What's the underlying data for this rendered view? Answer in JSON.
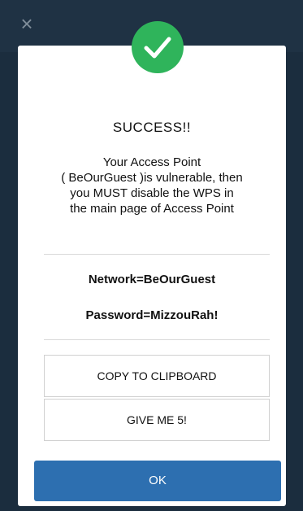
{
  "window": {
    "close_icon": "close-icon"
  },
  "dialog": {
    "icon": "check-icon",
    "accent_color": "#2fb45b",
    "title": "SUCCESS!!",
    "message_lines": [
      "Your Access Point",
      "( BeOurGuest )is vulnerable, then",
      "you MUST disable the WPS in",
      "the main page of Access Point"
    ],
    "network_label": "Network=BeOurGuest",
    "password_label": "Password=MizzouRah!",
    "copy_button": "COPY TO CLIPBOARD",
    "give_five_button": "GIVE ME 5!",
    "ok_button": "OK",
    "ok_color": "#2d6fb0"
  }
}
